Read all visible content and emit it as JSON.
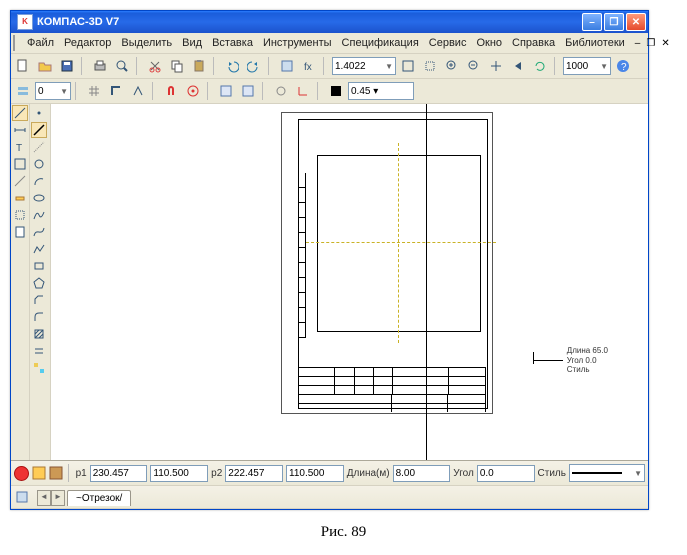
{
  "window": {
    "title": "КОМПАС-3D V7"
  },
  "menu": {
    "items": [
      "Файл",
      "Редактор",
      "Выделить",
      "Вид",
      "Вставка",
      "Инструменты",
      "Спецификация",
      "Сервис",
      "Окно",
      "Справка",
      "Библиотеки"
    ],
    "doc_min": "–",
    "doc_max": "❐",
    "doc_close": "✕"
  },
  "toolbar1": {
    "zoom_val": "1.4022",
    "combo2": "1000"
  },
  "toolbar2": {
    "layer_val": "0",
    "style": "0.45 ▾"
  },
  "info_panel": {
    "l1": "Длина 65.0",
    "l2": "Угол 0.0",
    "l3": "Стиль"
  },
  "props": {
    "lbl_p1": "p1",
    "x1": "230.457",
    "y1": "110.500",
    "lbl_p2": "p2",
    "x2": "222.457",
    "y2": "110.500",
    "lbl_len": "Длина(м)",
    "len": "8.00",
    "lbl_ang": "Угол",
    "ang": "0.0",
    "lbl_style": "Стиль"
  },
  "tabs": {
    "active": "Отрезок"
  },
  "caption": "Рис. 89"
}
